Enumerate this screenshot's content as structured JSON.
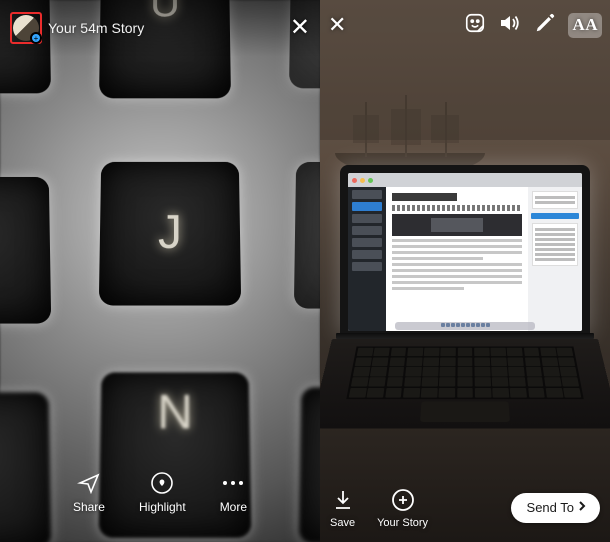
{
  "left": {
    "header": {
      "your_label": "Your",
      "time_label": "54m",
      "story_label": "Story"
    },
    "keys": {
      "u": "U",
      "j": "J",
      "n": "N"
    },
    "footer": {
      "share_label": "Share",
      "highlight_label": "Highlight",
      "more_label": "More"
    }
  },
  "right": {
    "tools": {
      "text_label": "AA"
    },
    "footer": {
      "save_label": "Save",
      "your_story_label": "Your Story",
      "send_to_label": "Send To"
    }
  }
}
